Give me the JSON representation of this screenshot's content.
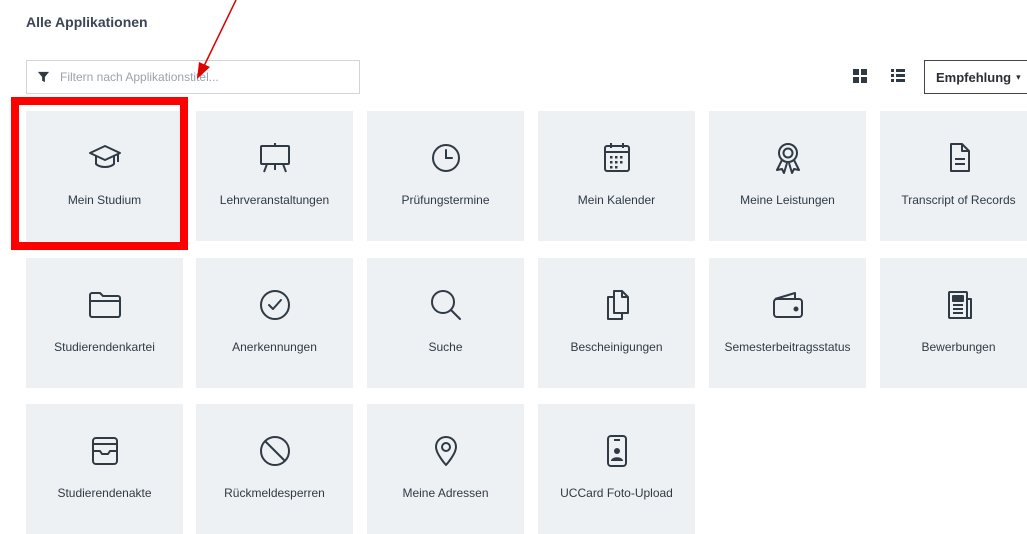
{
  "page": {
    "title": "Alle Applikationen"
  },
  "filter": {
    "placeholder": "Filtern nach Applikationstitel...",
    "value": ""
  },
  "view": {
    "grid_icon": "grid-view-icon",
    "list_icon": "list-view-icon"
  },
  "sort": {
    "label": "Empfehlung",
    "caret": "▾"
  },
  "colors": {
    "tile_bg": "#edf1f4",
    "highlight": "#ff0000",
    "text": "#2f3a45"
  },
  "tiles": [
    {
      "label": "Mein Studium",
      "icon": "graduation-cap-icon"
    },
    {
      "label": "Lehrveranstaltungen",
      "icon": "easel-board-icon"
    },
    {
      "label": "Prüfungstermine",
      "icon": "clock-icon"
    },
    {
      "label": "Mein Kalender",
      "icon": "calendar-icon"
    },
    {
      "label": "Meine Leistungen",
      "icon": "award-ribbon-icon"
    },
    {
      "label": "Transcript of Records",
      "icon": "document-icon"
    },
    {
      "label": "Studierendenkartei",
      "icon": "folder-icon"
    },
    {
      "label": "Anerkennungen",
      "icon": "check-circle-icon"
    },
    {
      "label": "Suche",
      "icon": "search-icon"
    },
    {
      "label": "Bescheinigungen",
      "icon": "documents-copy-icon"
    },
    {
      "label": "Semesterbeitragsstatus",
      "icon": "wallet-icon"
    },
    {
      "label": "Bewerbungen",
      "icon": "newspaper-icon"
    },
    {
      "label": "Studierendenakte",
      "icon": "inbox-tray-icon"
    },
    {
      "label": "Rückmeldesperren",
      "icon": "ban-icon"
    },
    {
      "label": "Meine Adressen",
      "icon": "map-pin-icon"
    },
    {
      "label": "UCCard Foto-Upload",
      "icon": "id-card-phone-icon"
    }
  ]
}
